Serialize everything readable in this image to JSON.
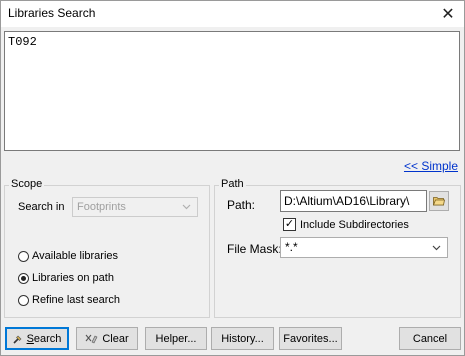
{
  "window": {
    "title": "Libraries Search",
    "close_glyph": "✕"
  },
  "query": {
    "text": "T092"
  },
  "simple_link": "<< Simple",
  "scope": {
    "title": "Scope",
    "search_in_label": "Search in",
    "search_in_value": "Footprints",
    "options": [
      {
        "label": "Available libraries",
        "selected": false
      },
      {
        "label": "Libraries on path",
        "selected": true
      },
      {
        "label": "Refine last search",
        "selected": false
      }
    ]
  },
  "path": {
    "title": "Path",
    "path_label": "Path:",
    "path_value": "D:\\Altium\\AD16\\Library\\",
    "include_subdirs_label": "Include Subdirectories",
    "include_subdirs_checked": true,
    "file_mask_label": "File Mask:",
    "file_mask_value": "*.*"
  },
  "buttons": {
    "search": {
      "label_first": "S",
      "label_rest": "earch"
    },
    "clear": "Clear",
    "helper": "Helper...",
    "history": "History...",
    "favorites": "Favorites...",
    "cancel": "Cancel"
  },
  "icons": {
    "close": "close-icon",
    "dropdown": "chevron-down-icon",
    "folder": "folder-browse-icon",
    "search": "search-icon",
    "clear": "clear-icon"
  }
}
